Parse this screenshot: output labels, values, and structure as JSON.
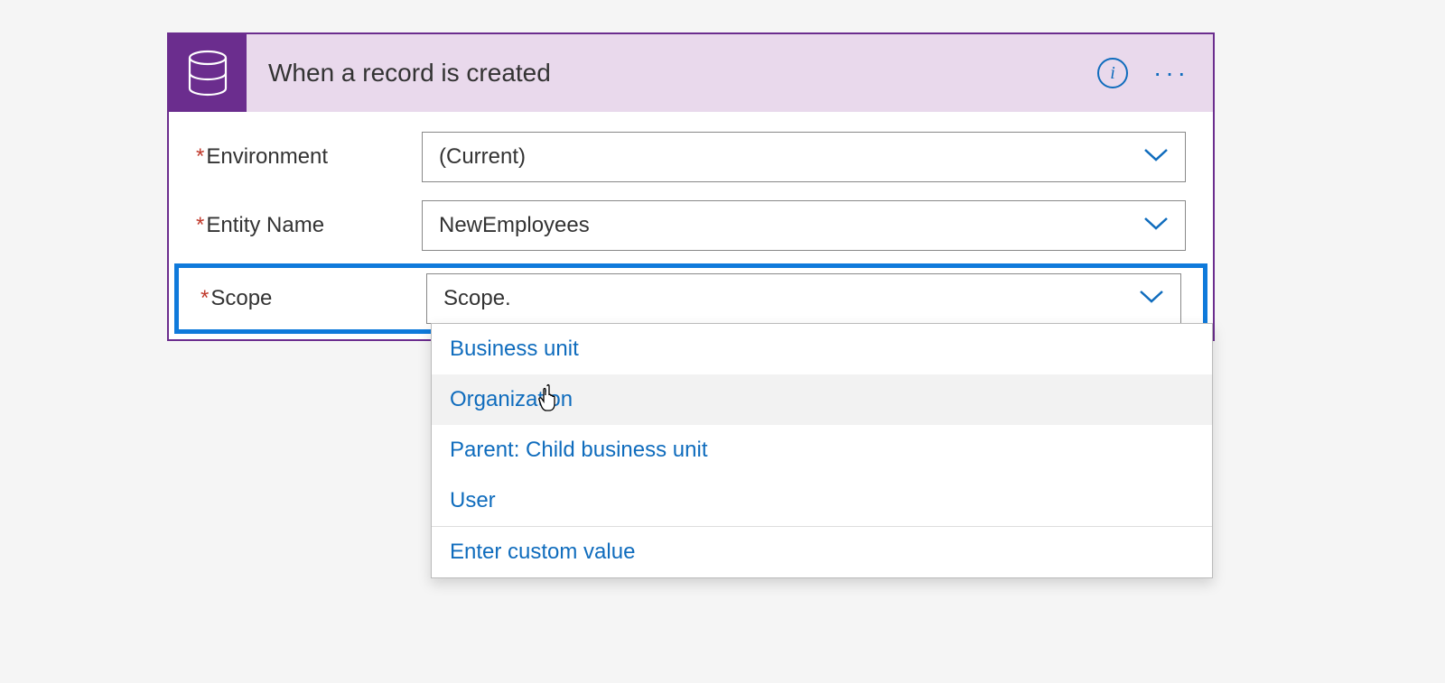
{
  "header": {
    "title": "When a record is created"
  },
  "fields": {
    "environment": {
      "label": "Environment",
      "value": "(Current)"
    },
    "entity": {
      "label": "Entity Name",
      "value": "NewEmployees"
    },
    "scope": {
      "label": "Scope",
      "value": "Scope."
    }
  },
  "dropdown": {
    "options": [
      "Business unit",
      "Organization",
      "Parent: Child business unit",
      "User"
    ],
    "custom": "Enter custom value"
  }
}
